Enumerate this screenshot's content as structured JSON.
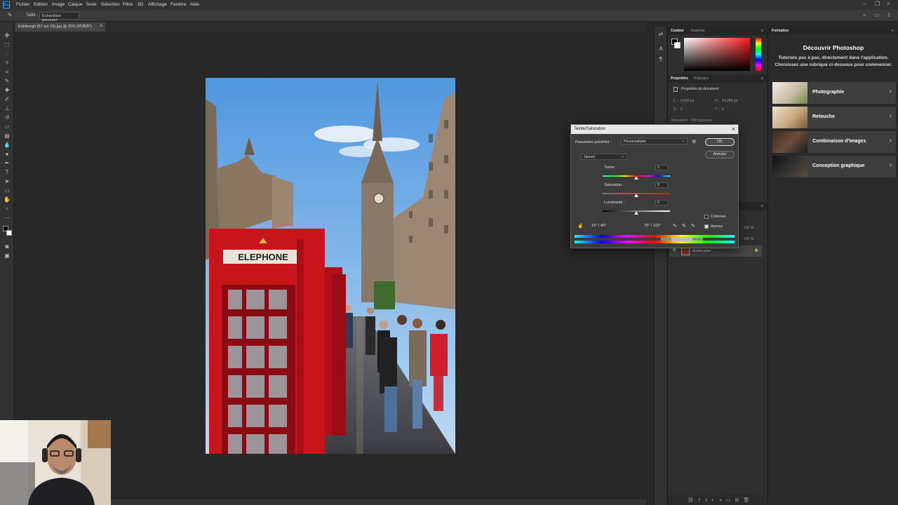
{
  "menu": [
    "Fichier",
    "Edition",
    "Image",
    "Calque",
    "Texte",
    "Sélection",
    "Filtre",
    "3D",
    "Affichage",
    "Fenêtre",
    "Aide"
  ],
  "options": {
    "size_label": "Taille :",
    "sample_value": "Échantillon ponctuel"
  },
  "doc_tab": {
    "title": "Edinburgh (57 sur 16).jpg @ 25% (RVB/8*)",
    "close": "×"
  },
  "color_panel": {
    "tab_active": "Couleur",
    "tab_other": "Nuancier"
  },
  "properties_panel": {
    "tab_active": "Propriétés",
    "tab_other": "Réglages",
    "section": "Propriétés du document",
    "w_label": "L :",
    "w_value": "9,092 po",
    "h_label": "H :",
    "h_value": "14,280 po",
    "x_label": "X :",
    "x_value": "0",
    "y_label": "Y :",
    "y_value": "0",
    "resolution": "Résolution : 300 px/pouce"
  },
  "layers_panel": {
    "layer_name": "Arrière-plan",
    "pct1": "100 %",
    "pct2": "100 %"
  },
  "dialog": {
    "title": "Teinte/Saturation",
    "close": "×",
    "preset_label": "Paramètre prédéfini :",
    "preset_value": "Personnalisée",
    "channel_value": "Jaunes",
    "ok": "OK",
    "cancel": "Annuler",
    "hue_label": "Teinte :",
    "hue_value": "0",
    "sat_label": "Saturation :",
    "sat_value": "0",
    "light_label": "Luminosité :",
    "light_value": "0",
    "colorize_label": "Coloriser",
    "preview_label": "Aperçu",
    "range_left": "15° / 45°",
    "range_right": "75° \\ 105°",
    "colorize_checked": false,
    "preview_checked": true
  },
  "learn_panel": {
    "tab": "Formation",
    "title": "Découvrir Photoshop",
    "description": "Tutoriels pas à pas, directement dans l'application. Choisissez une rubrique ci-dessous pour commencer.",
    "cards": [
      "Photographie",
      "Retouche",
      "Combinaison d'images",
      "Conception graphique"
    ]
  },
  "photo_sign": "ELEPHONE",
  "colors": {
    "accent": "#31a8ff",
    "phonebox_red": "#c8141b",
    "sky": "#7db8ea"
  }
}
